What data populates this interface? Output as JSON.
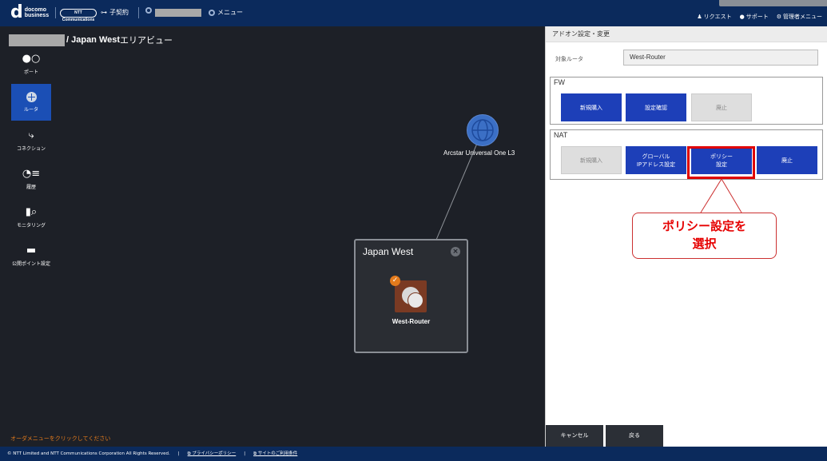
{
  "header": {
    "logo_mark": "d",
    "logo_text_1": "docomo",
    "logo_text_2": "business",
    "ntt_logo_text": "NTT Communications",
    "contract_label": "子契約",
    "menu_label": "メニュー",
    "links": [
      "リクエスト",
      "サポート",
      "管理者メニュー"
    ]
  },
  "map": {
    "breadcrumb_bold": "/ Japan West",
    "breadcrumb_rest": " エリアビュー",
    "cloud_label": "Arcstar Universal One L3",
    "area_title": "Japan West",
    "router_label": "West-Router",
    "order_message": "オーダメニューをクリックしてください"
  },
  "sidebar": {
    "items": [
      {
        "label": "ポート",
        "icon": "port-icon"
      },
      {
        "label": "ルータ",
        "icon": "router-icon"
      },
      {
        "label": "コネクション",
        "icon": "connection-icon"
      },
      {
        "label": "履歴",
        "icon": "history-icon"
      },
      {
        "label": "モニタリング",
        "icon": "monitoring-icon"
      },
      {
        "label": "公開ポイント設定",
        "icon": "publish-point-icon"
      }
    ]
  },
  "panel": {
    "title": "アドオン設定・変更",
    "target_label": "対象ルータ",
    "target_value": "West-Router",
    "fw": {
      "title": "FW",
      "buttons": [
        "新規購入",
        "設定確認",
        "廃止"
      ]
    },
    "nat": {
      "title": "NAT",
      "buttons": [
        "新規購入",
        "グローバル\nIPアドレス設定",
        "ポリシー\n設定",
        "廃止"
      ]
    },
    "callout_line1": "ポリシー設定を",
    "callout_line2": "選択",
    "cancel_label": "キャンセル",
    "back_label": "戻る"
  },
  "footer": {
    "copyright": "© NTT Limited and NTT Communications Corporation All Rights Reserved.",
    "privacy": "プライバシーポリシー",
    "terms": "サイトのご利用条件"
  },
  "colors": {
    "header_bg": "#0b2a5c",
    "active_blue": "#1b4fb5",
    "button_blue": "#1d3fb8",
    "highlight_red": "#e00000",
    "router_brown": "#7a3a23",
    "accent_orange": "#e47b1c"
  }
}
